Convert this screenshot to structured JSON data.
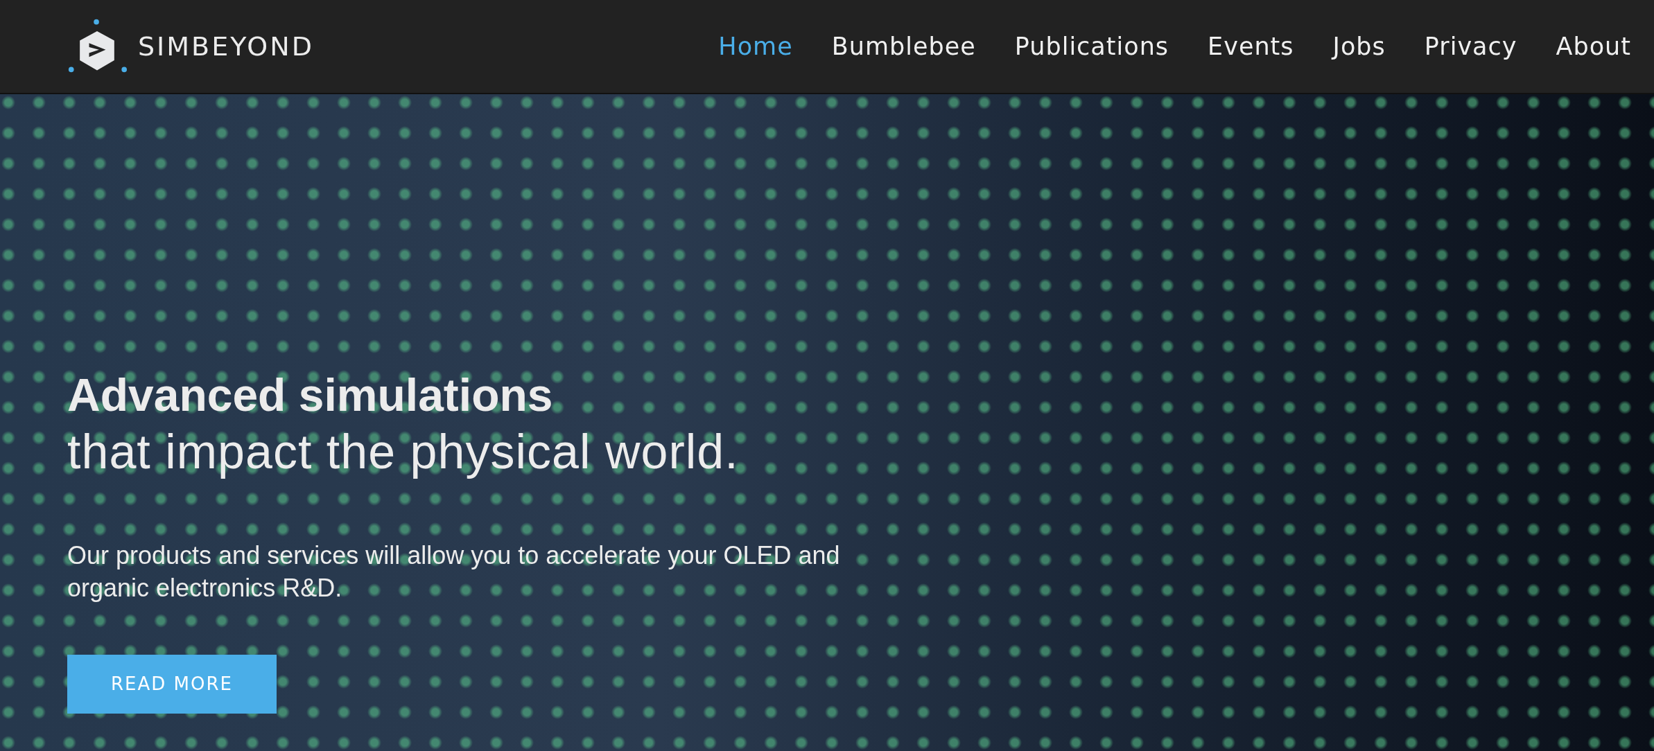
{
  "header": {
    "logo_text": "SIMBEYOND",
    "nav": [
      {
        "label": "Home",
        "selected": true
      },
      {
        "label": "Bumblebee",
        "selected": false
      },
      {
        "label": "Publications",
        "selected": false
      },
      {
        "label": "Events",
        "selected": false
      },
      {
        "label": "Jobs",
        "selected": false
      },
      {
        "label": "Privacy",
        "selected": false
      },
      {
        "label": "About",
        "selected": false
      }
    ]
  },
  "hero": {
    "title": "Advanced simulations",
    "subtitle": "that impact the physical world.",
    "text": "Our products and services will allow you to accelerate your OLED and organic electronics R&D.",
    "button": "READ MORE"
  }
}
